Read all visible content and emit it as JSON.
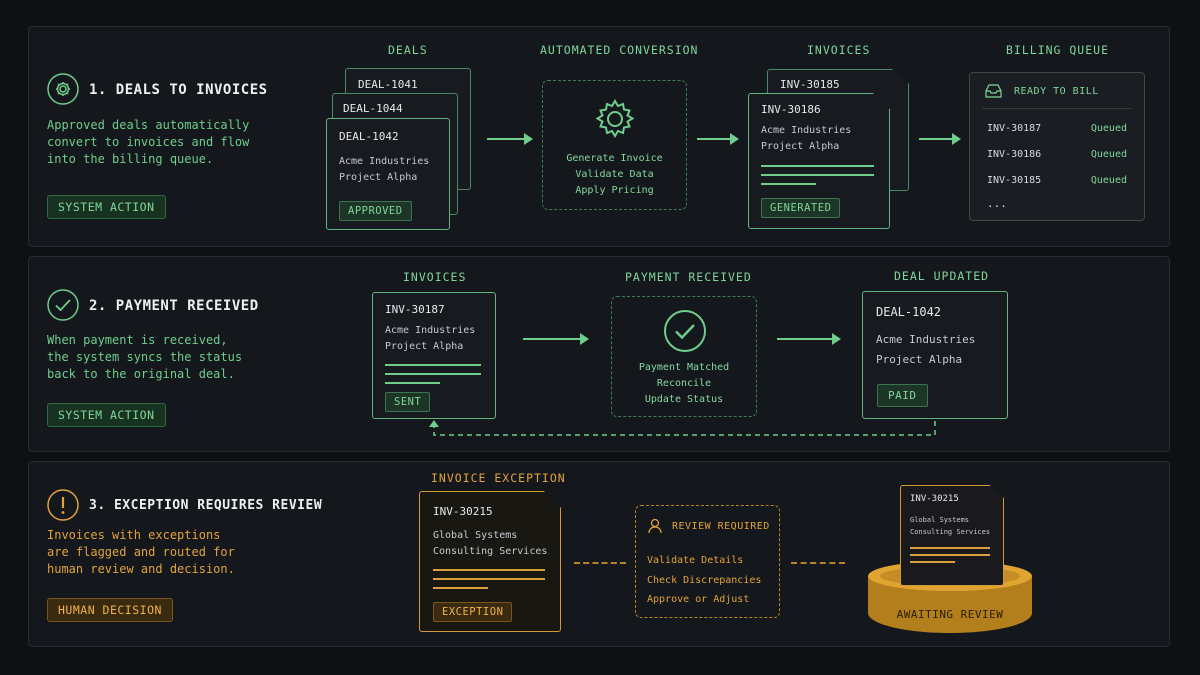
{
  "section1": {
    "title": "1. DEALS TO INVOICES",
    "desc": [
      "Approved deals automatically",
      "convert to invoices and flow",
      "into the billing queue."
    ],
    "badge": "SYSTEM ACTION",
    "col_deals": "DEALS",
    "col_conversion": "AUTOMATED CONVERSION",
    "col_invoices": "INVOICES",
    "col_queue": "BILLING QUEUE",
    "deal_back1": "DEAL-1041",
    "deal_back2": "DEAL-1044",
    "deal_front": {
      "id": "DEAL-1042",
      "line1": "Acme Industries",
      "line2": "Project Alpha",
      "badge": "APPROVED"
    },
    "conversion_steps": [
      "Generate Invoice",
      "Validate Data",
      "Apply Pricing"
    ],
    "invoice_back": "INV-30185",
    "invoice_front": {
      "id": "INV-30186",
      "line1": "Acme Industries",
      "line2": "Project Alpha",
      "badge": "GENERATED"
    },
    "queue": {
      "header": "READY TO BILL",
      "rows": [
        {
          "id": "INV-30187",
          "status": "Queued"
        },
        {
          "id": "INV-30186",
          "status": "Queued"
        },
        {
          "id": "INV-30185",
          "status": "Queued"
        }
      ],
      "more": "..."
    }
  },
  "section2": {
    "title": "2. PAYMENT RECEIVED",
    "desc": [
      "When payment is received,",
      "the system syncs the status",
      "back to the original deal."
    ],
    "badge": "SYSTEM ACTION",
    "col_invoices": "INVOICES",
    "col_payment": "PAYMENT RECEIVED",
    "col_deal": "DEAL UPDATED",
    "invoice": {
      "id": "INV-30187",
      "line1": "Acme Industries",
      "line2": "Project Alpha",
      "badge": "SENT"
    },
    "payment_steps": [
      "Payment Matched",
      "Reconcile",
      "Update Status"
    ],
    "deal": {
      "id": "DEAL-1042",
      "line1": "Acme Industries",
      "line2": "Project Alpha",
      "badge": "PAID"
    }
  },
  "section3": {
    "title": "3. EXCEPTION REQUIRES REVIEW",
    "desc": [
      "Invoices with exceptions",
      "are flagged and routed for",
      "human review and decision."
    ],
    "badge": "HUMAN DECISION",
    "col_exception": "INVOICE EXCEPTION",
    "invoice": {
      "id": "INV-30215",
      "line1": "Global Systems",
      "line2": "Consulting Services",
      "badge": "EXCEPTION"
    },
    "review": {
      "header": "REVIEW REQUIRED",
      "steps": [
        "Validate Details",
        "Check Discrepancies",
        "Approve or Adjust"
      ]
    },
    "pedestal_card": {
      "id": "INV-30215",
      "line1": "Global Systems",
      "line2": "Consulting Services"
    },
    "pedestal_label": "AWAITING REVIEW"
  },
  "colors": {
    "green": "#6fce8c",
    "amber": "#e3a33a",
    "background": "#0e1014",
    "panel": "#14171c"
  }
}
